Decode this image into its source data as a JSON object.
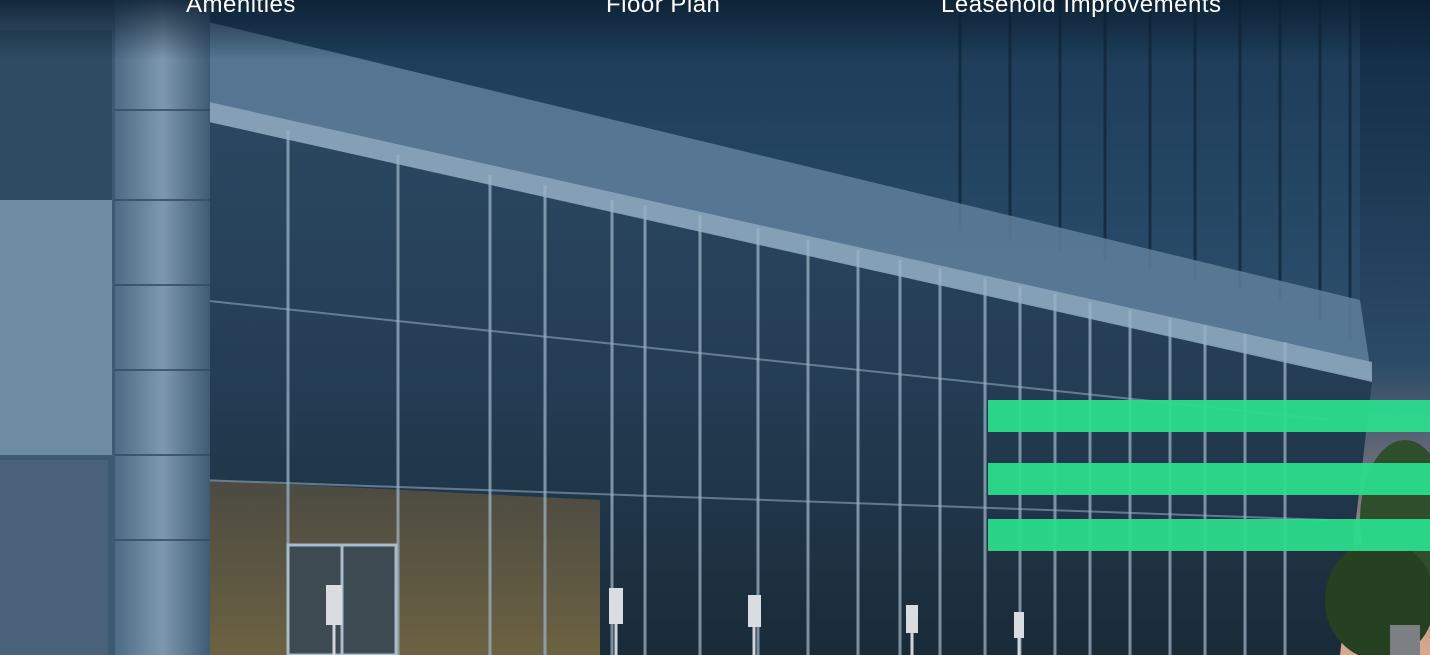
{
  "nav": {
    "items": [
      {
        "label": "Amenities"
      },
      {
        "label": "Floor Plan"
      },
      {
        "label": "Leasehold Improvements"
      }
    ]
  },
  "hero": {
    "accent_color": "#2bdc8c",
    "sky_top": "#0f2a44",
    "sky_bottom": "#d9a98e"
  }
}
